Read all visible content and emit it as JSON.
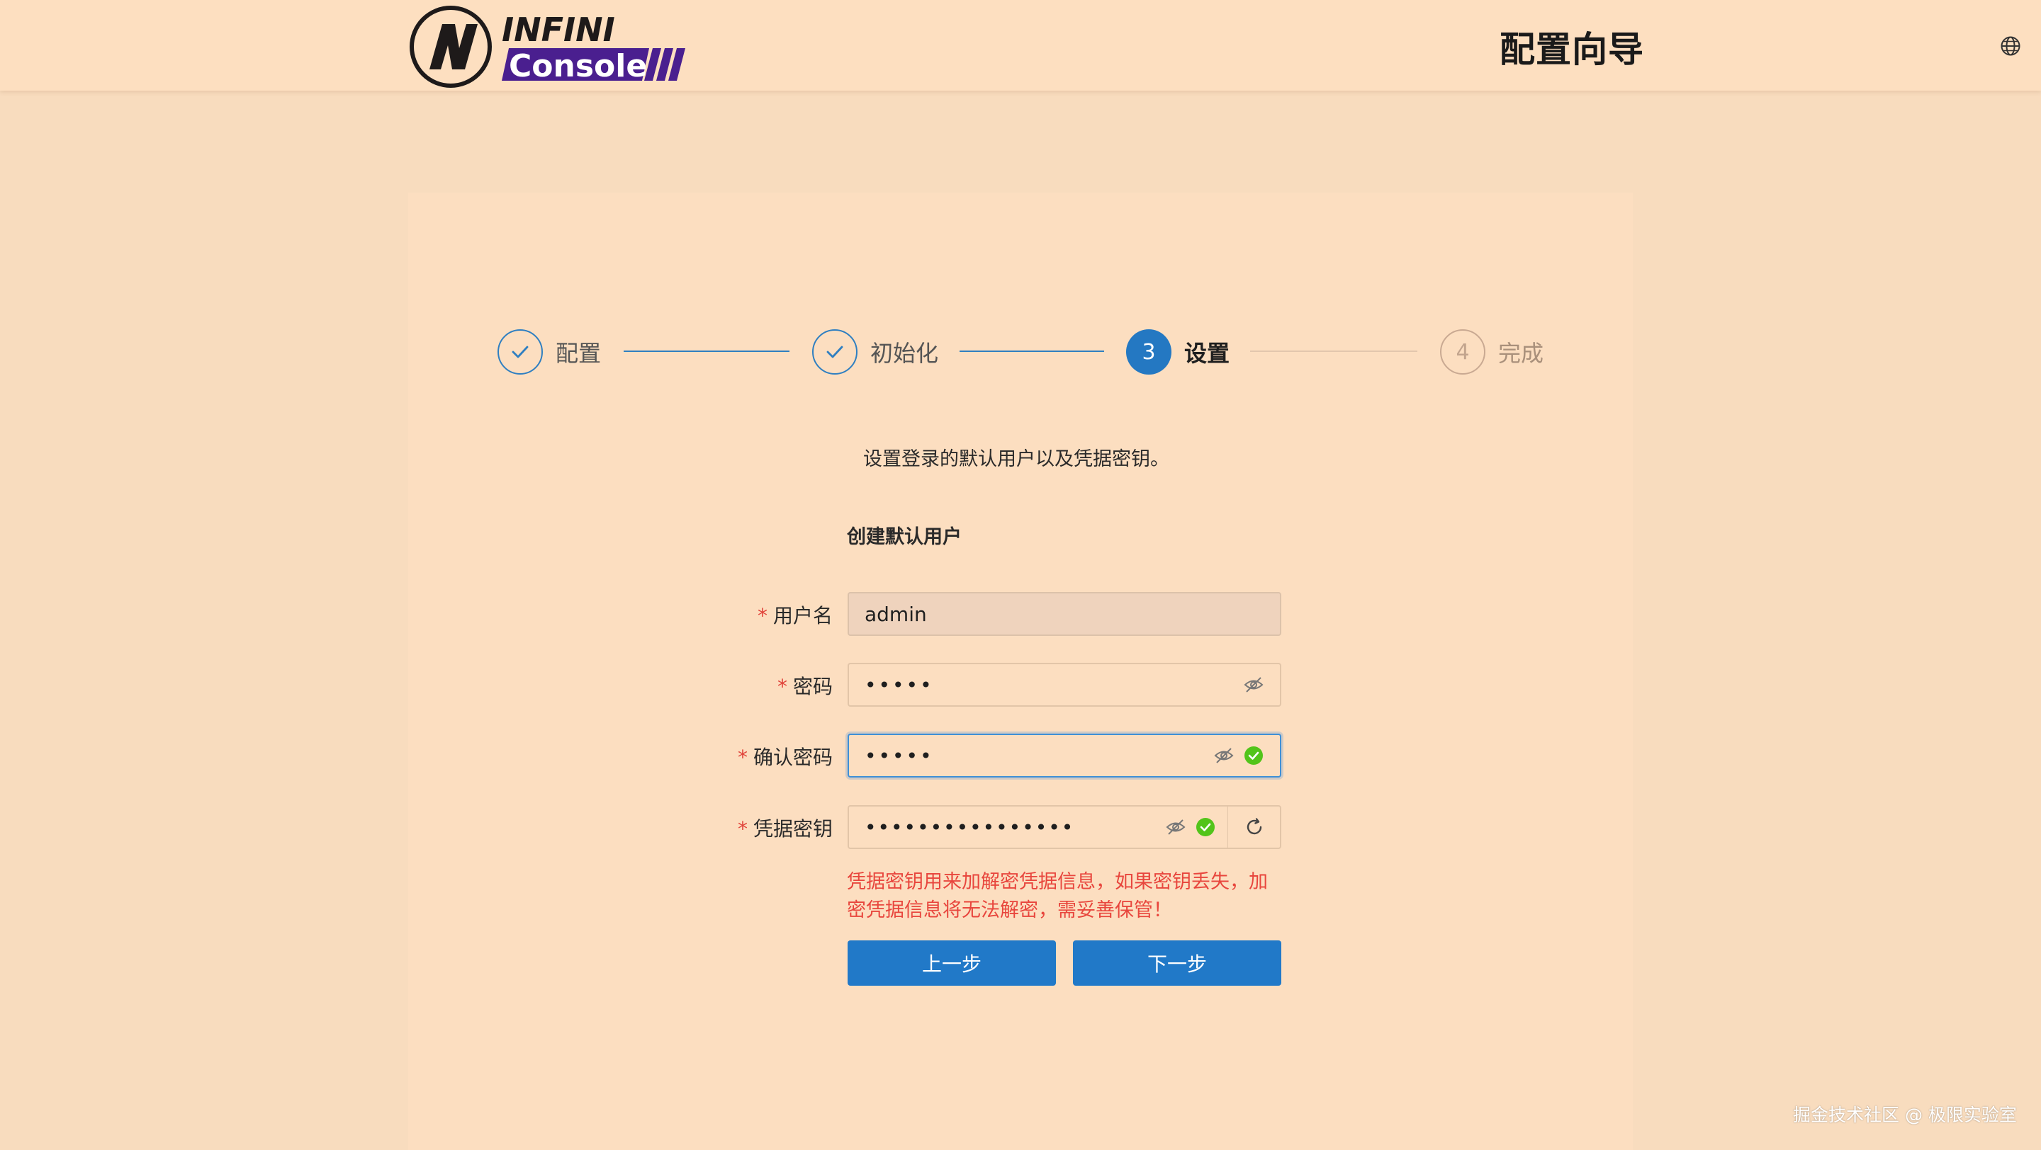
{
  "header": {
    "logo": {
      "text_top": "INFINI",
      "text_bottom": "Console",
      "mark": "N"
    },
    "title": "配置向导",
    "language_icon": "globe-icon"
  },
  "steps": [
    {
      "label": "配置",
      "status": "done",
      "icon": "check-icon"
    },
    {
      "label": "初始化",
      "status": "done",
      "icon": "check-icon"
    },
    {
      "number": "3",
      "label": "设置",
      "status": "active"
    },
    {
      "number": "4",
      "label": "完成",
      "status": "wait"
    }
  ],
  "description": "设置登录的默认用户以及凭据密钥。",
  "section_title": "创建默认用户",
  "form": {
    "username": {
      "label": "用户名",
      "required": "*",
      "value": "admin"
    },
    "password": {
      "label": "密码",
      "required": "*",
      "value": "•••••",
      "toggle_icon": "eye-off-icon"
    },
    "confirm_password": {
      "label": "确认密码",
      "required": "*",
      "value": "•••••",
      "toggle_icon": "eye-off-icon",
      "status_icon": "check-circle-icon"
    },
    "credential_secret": {
      "label": "凭据密钥",
      "required": "*",
      "value": "••••••••••••••••",
      "toggle_icon": "eye-off-icon",
      "status_icon": "check-circle-icon",
      "refresh_icon": "refresh-icon"
    },
    "secret_warning": "凭据密钥用来加解密凭据信息，如果密钥丢失，加密凭据信息将无法解密，需妥善保管！"
  },
  "buttons": {
    "prev": "上一步",
    "next": "下一步"
  },
  "watermark": "掘金技术社区 @ 极限实验室",
  "colors": {
    "primary": "#2179c8",
    "error": "#e8463d",
    "success": "#52c41a",
    "background": "#f8dcbe"
  }
}
